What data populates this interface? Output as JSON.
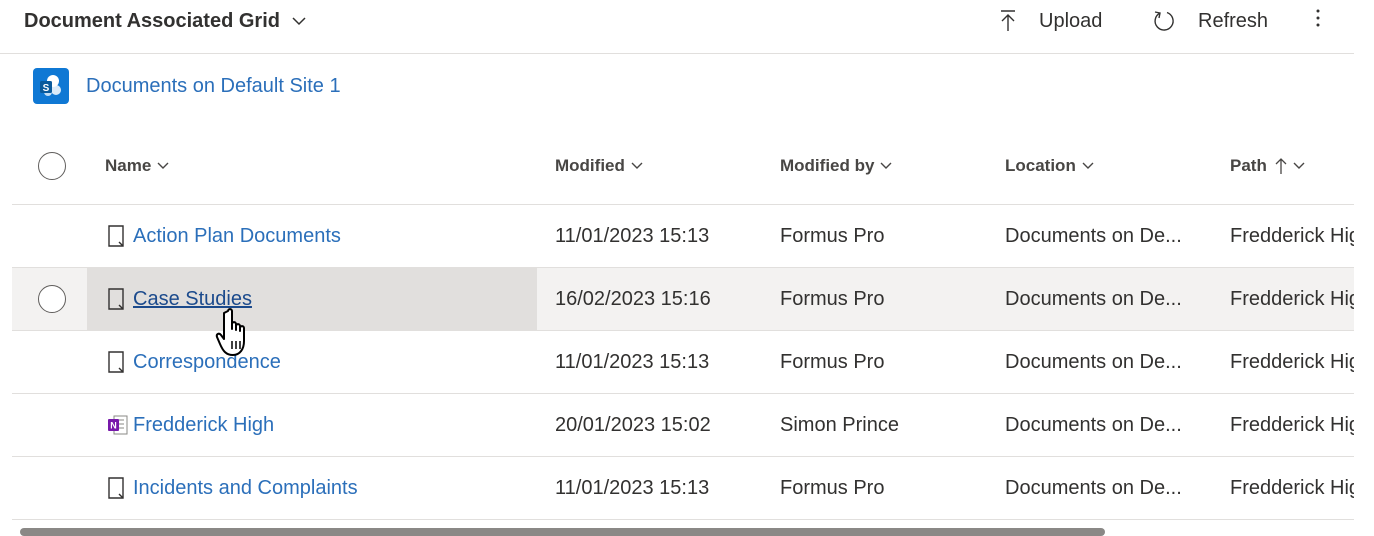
{
  "header": {
    "title": "Document Associated Grid",
    "upload_label": "Upload",
    "refresh_label": "Refresh"
  },
  "site": {
    "label": "Documents on Default Site 1",
    "icon": "sharepoint-icon",
    "icon_color": "#0f78d4"
  },
  "columns": {
    "name": "Name",
    "modified": "Modified",
    "modified_by": "Modified by",
    "location": "Location",
    "path": "Path"
  },
  "rows": [
    {
      "name": "Action Plan Documents",
      "modified": "11/01/2023 15:13",
      "modified_by": "Formus Pro",
      "location": "Documents on De...",
      "path": "Fredderick High",
      "icon": "document-icon"
    },
    {
      "name": "Case Studies",
      "modified": "16/02/2023 15:16",
      "modified_by": "Formus Pro",
      "location": "Documents on De...",
      "path": "Fredderick High",
      "icon": "document-icon"
    },
    {
      "name": "Correspondence",
      "modified": "11/01/2023 15:13",
      "modified_by": "Formus Pro",
      "location": "Documents on De...",
      "path": "Fredderick High",
      "icon": "document-icon"
    },
    {
      "name": "Fredderick High",
      "modified": "20/01/2023 15:02",
      "modified_by": "Simon Prince",
      "location": "Documents on De...",
      "path": "Fredderick High",
      "icon": "onenote-icon"
    },
    {
      "name": "Incidents and Complaints",
      "modified": "11/01/2023 15:13",
      "modified_by": "Formus Pro",
      "location": "Documents on De...",
      "path": "Fredderick High",
      "icon": "document-icon"
    }
  ],
  "colors": {
    "link": "#2b6fba",
    "hover_row": "#f3f2f1",
    "border": "#e1dfdd"
  }
}
